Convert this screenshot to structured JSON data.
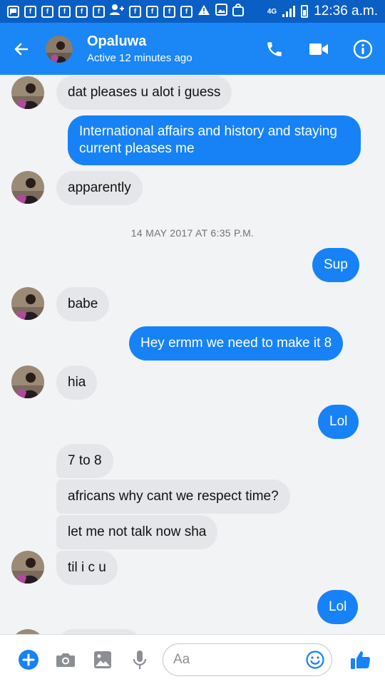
{
  "status_bar": {
    "network": "4G",
    "time": "12:36 a.m."
  },
  "header": {
    "contact_name": "Opaluwa",
    "active_status": "Active 12 minutes ago"
  },
  "chat": {
    "messages": [
      {
        "direction": "in",
        "text": "dat pleases u alot i guess"
      },
      {
        "direction": "out",
        "text": "International affairs and history and staying current pleases me"
      },
      {
        "direction": "in",
        "text": "apparently"
      },
      {
        "direction": "out",
        "text": "Sup"
      },
      {
        "direction": "in",
        "text": "babe"
      },
      {
        "direction": "out",
        "text": "Hey ermm we need to make it 8"
      },
      {
        "direction": "in",
        "text": "hia"
      },
      {
        "direction": "out",
        "text": "Lol"
      },
      {
        "direction": "in",
        "text": "7 to 8"
      },
      {
        "direction": "in",
        "text": "africans why cant we respect time?"
      },
      {
        "direction": "in",
        "text": "let me not talk now sha"
      },
      {
        "direction": "in",
        "text": "til i c u"
      },
      {
        "direction": "out",
        "text": "Lol"
      }
    ],
    "timestamp": "14 MAY 2017 AT 6:35 P.M."
  },
  "composer": {
    "placeholder": "Aa"
  },
  "colors": {
    "header_blue": "#1b86f5",
    "statusbar_blue": "#0a5fc4",
    "outgoing_bubble": "#1782f6",
    "incoming_bubble": "#e5e6e9"
  },
  "icons": [
    "back-arrow-icon",
    "phone-icon",
    "video-camera-icon",
    "info-icon",
    "plus-icon",
    "camera-icon",
    "image-icon",
    "microphone-icon",
    "emoji-icon",
    "thumbs-up-icon"
  ]
}
